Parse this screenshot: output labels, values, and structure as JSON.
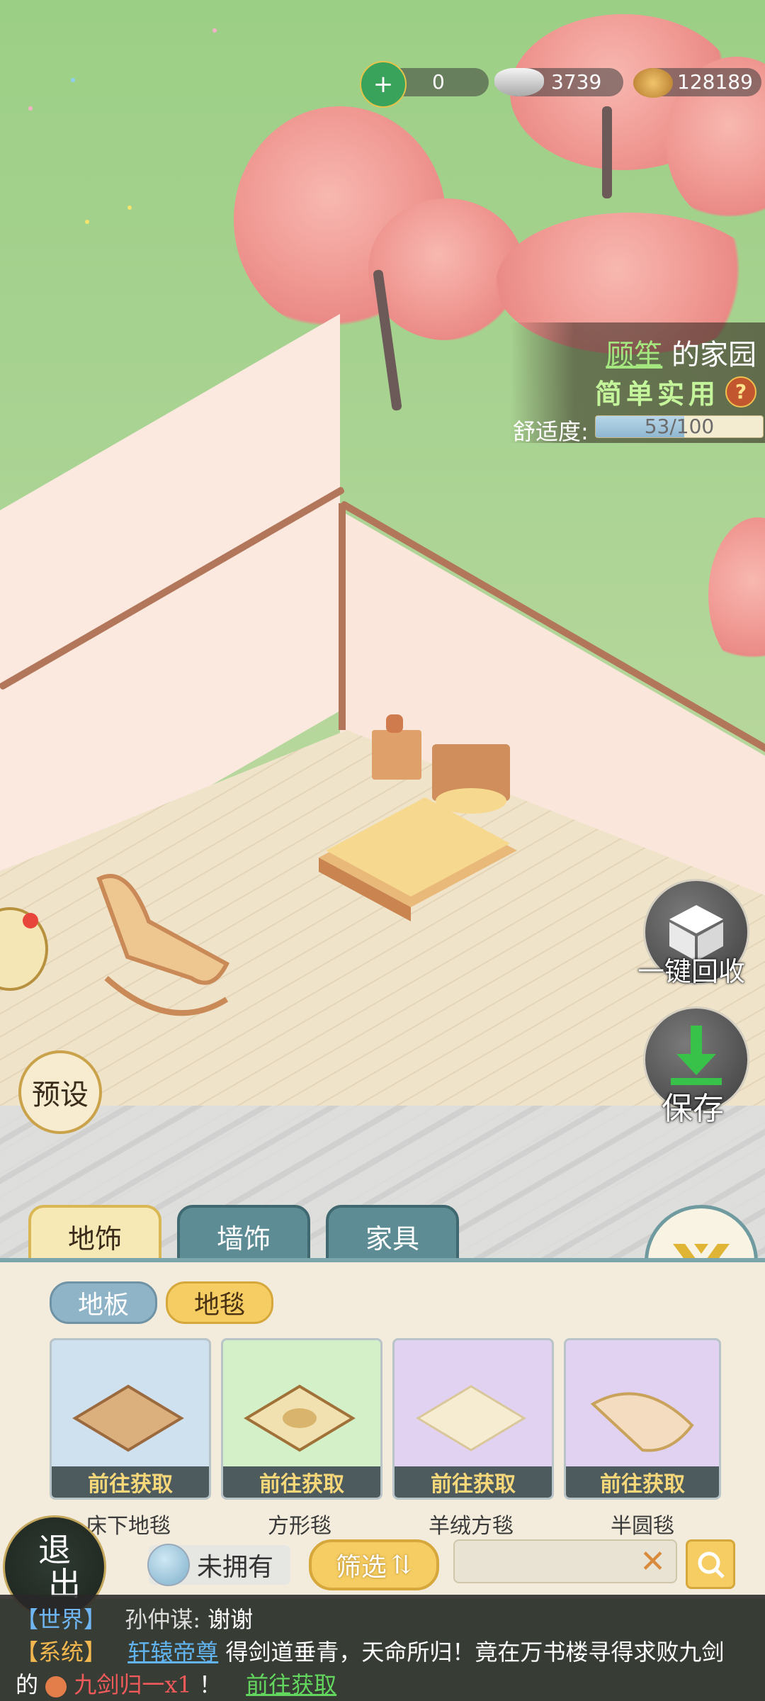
{
  "currencies": [
    {
      "icon": "jade-dragon-icon",
      "value": "0"
    },
    {
      "icon": "silver-ingot-icon",
      "value": "3739"
    },
    {
      "icon": "copper-coins-icon",
      "value": "128189"
    }
  ],
  "garden": {
    "owner_name": "顾笙",
    "owner_suffix": "的家园",
    "style": "简单实用",
    "help_mark": "?",
    "comfort_label": "舒适度:",
    "comfort_text": "53/100",
    "comfort_value": 53,
    "comfort_max": 100
  },
  "side_buttons": {
    "recycle_label": "一键回收",
    "save_label": "保存",
    "preset_label": "预设"
  },
  "tabs": [
    {
      "label": "地饰",
      "active": true
    },
    {
      "label": "墙饰",
      "active": false
    },
    {
      "label": "家具",
      "active": false
    }
  ],
  "subtabs": [
    {
      "label": "地板",
      "active": false
    },
    {
      "label": "地毯",
      "active": true
    }
  ],
  "items": [
    {
      "name": "床下地毯",
      "action": "前往获取",
      "bg": "#cfe0ef"
    },
    {
      "name": "方形毯",
      "action": "前往获取",
      "bg": "#d3f0c8"
    },
    {
      "name": "羊绒方毯",
      "action": "前往获取",
      "bg": "#e2d2f2"
    },
    {
      "name": "半圆毯",
      "action": "前往获取",
      "bg": "#e2d2f2"
    }
  ],
  "controls": {
    "owned_label": "未拥有",
    "filter_label": "筛选",
    "filter_icon": "⇅",
    "search_value": "",
    "clear_glyph": "✕",
    "exit_label_1": "退",
    "exit_label_2": "出"
  },
  "chat": {
    "line1": {
      "channel": "【世界】",
      "speaker": "孙仲谋:",
      "message": "谢谢"
    },
    "line2": {
      "channel": "【系统】",
      "player": "轩辕帝尊",
      "message": "得剑道垂青，天命所归！竟在万书楼寻得求败九剑"
    },
    "line3": {
      "prefix": "的",
      "item": "九剑归一x1",
      "suffix": "！",
      "link": "前往获取"
    }
  }
}
